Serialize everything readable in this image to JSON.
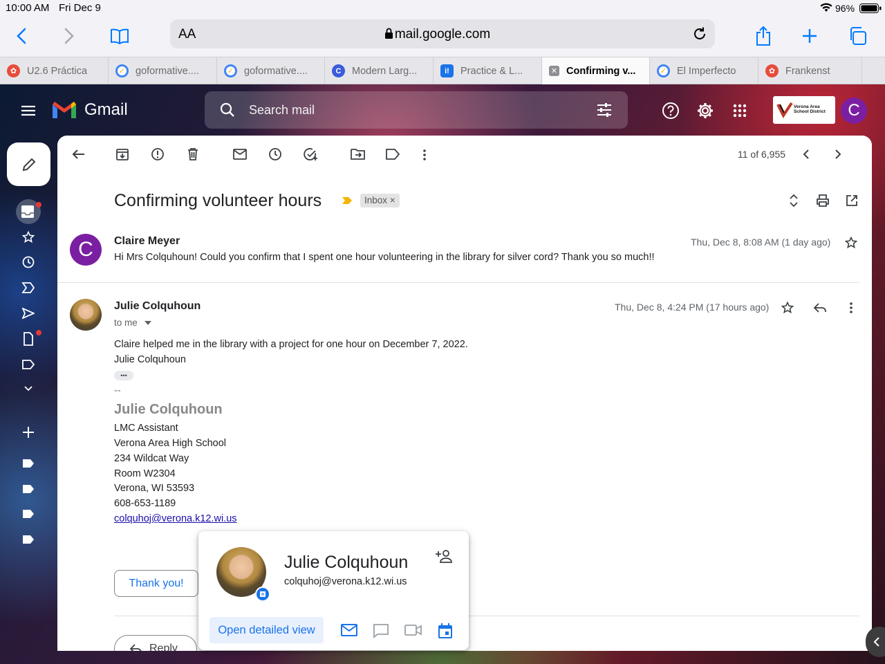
{
  "status": {
    "time": "10:00 AM",
    "date": "Fri Dec 9",
    "battery": "96%"
  },
  "browser": {
    "text_size_label": "AA",
    "url": "mail.google.com",
    "tabs": [
      {
        "label": "U2.6 Práctica",
        "icon": "red-gear-icon",
        "active": false
      },
      {
        "label": "goformative....",
        "icon": "goformative-check-icon",
        "active": false
      },
      {
        "label": "goformative....",
        "icon": "goformative-check-icon",
        "active": false
      },
      {
        "label": "Modern Larg...",
        "icon": "blue-c-icon",
        "active": false
      },
      {
        "label": "Practice & L...",
        "icon": "blue-square-icon",
        "active": false
      },
      {
        "label": "Confirming v...",
        "icon": "close-tab-icon",
        "active": true
      },
      {
        "label": "El Imperfecto",
        "icon": "goformative-check-icon",
        "active": false
      },
      {
        "label": "Frankenst",
        "icon": "red-gear-icon",
        "active": false
      }
    ]
  },
  "gmail": {
    "title": "Gmail",
    "search_placeholder": "Search mail",
    "account_initial": "C",
    "district_logo_text": "Verona Area School District",
    "counter": "11 of 6,955"
  },
  "thread": {
    "subject": "Confirming volunteer hours",
    "label_chip": "Inbox",
    "label_chip_close": "×",
    "messages": [
      {
        "sender": "Claire Meyer",
        "initial": "C",
        "date": "Thu, Dec 8, 8:08 AM (1 day ago)",
        "snippet": "Hi Mrs Colquhoun! Could you confirm that I spent one hour volunteering in the library for silver cord? Thank you so much!!"
      },
      {
        "sender": "Julie Colquhoun",
        "to": "to me",
        "date": "Thu, Dec 8, 4:24 PM (17 hours ago)",
        "body_line1": "Claire helped me in the library with a project for one hour on December 7, 2022.",
        "body_line2": "Julie Colquhoun",
        "ellipsis": "•••",
        "sig_dash": "--",
        "sig_name": "Julie Colquhoun",
        "sig_lines": [
          "LMC Assistant",
          "Verona Area High School",
          "234 Wildcat Way",
          "Room W2304",
          "Verona, WI 53593",
          "608-653-1189"
        ],
        "sig_email": "colquhoj@verona.k12.wi.us"
      }
    ],
    "smart_reply": "Thank you!",
    "reply_label": "Reply"
  },
  "hover_card": {
    "name": "Julie Colquhoun",
    "email": "colquhoj@verona.k12.wi.us",
    "open_label": "Open detailed view"
  }
}
